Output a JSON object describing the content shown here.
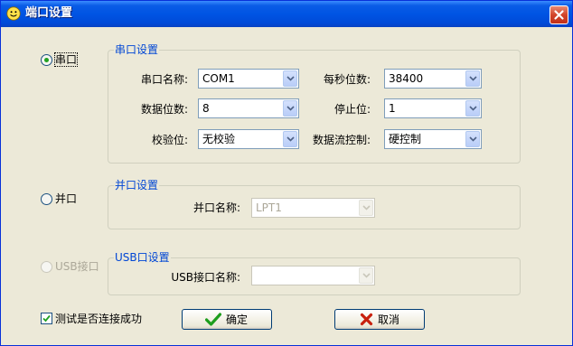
{
  "window": {
    "title": "端口设置",
    "close_icon": "close-icon",
    "app_icon": "smiley-icon"
  },
  "port_type": {
    "serial_label": "串口",
    "parallel_label": "并口",
    "usb_label": "USB接口",
    "selected": "serial"
  },
  "serial_group": {
    "title": "串口设置",
    "port_name_label": "串口名称:",
    "port_name_value": "COM1",
    "baud_label": "每秒位数:",
    "baud_value": "38400",
    "data_bits_label": "数据位数:",
    "data_bits_value": "8",
    "stop_bits_label": "停止位:",
    "stop_bits_value": "1",
    "parity_label": "校验位:",
    "parity_value": "无校验",
    "flow_label": "数据流控制:",
    "flow_value": "硬控制"
  },
  "parallel_group": {
    "title": "并口设置",
    "port_name_label": "并口名称:",
    "port_name_value": "LPT1"
  },
  "usb_group": {
    "title": "USB口设置",
    "port_name_label": "USB接口名称:",
    "port_name_value": ""
  },
  "footer": {
    "test_connection_label": "测试是否连接成功",
    "test_connection_checked": true,
    "ok_label": "确定",
    "ok_icon": "checkmark-icon",
    "cancel_label": "取消",
    "cancel_icon": "x-icon"
  },
  "colors": {
    "titlebar": "#0054e3",
    "window_bg": "#ece9d8",
    "group_title": "#0046d5",
    "field_border": "#7f9db9",
    "disabled_text": "#aca899",
    "ok_icon": "#1e9e1e",
    "cancel_icon": "#c8200e"
  }
}
